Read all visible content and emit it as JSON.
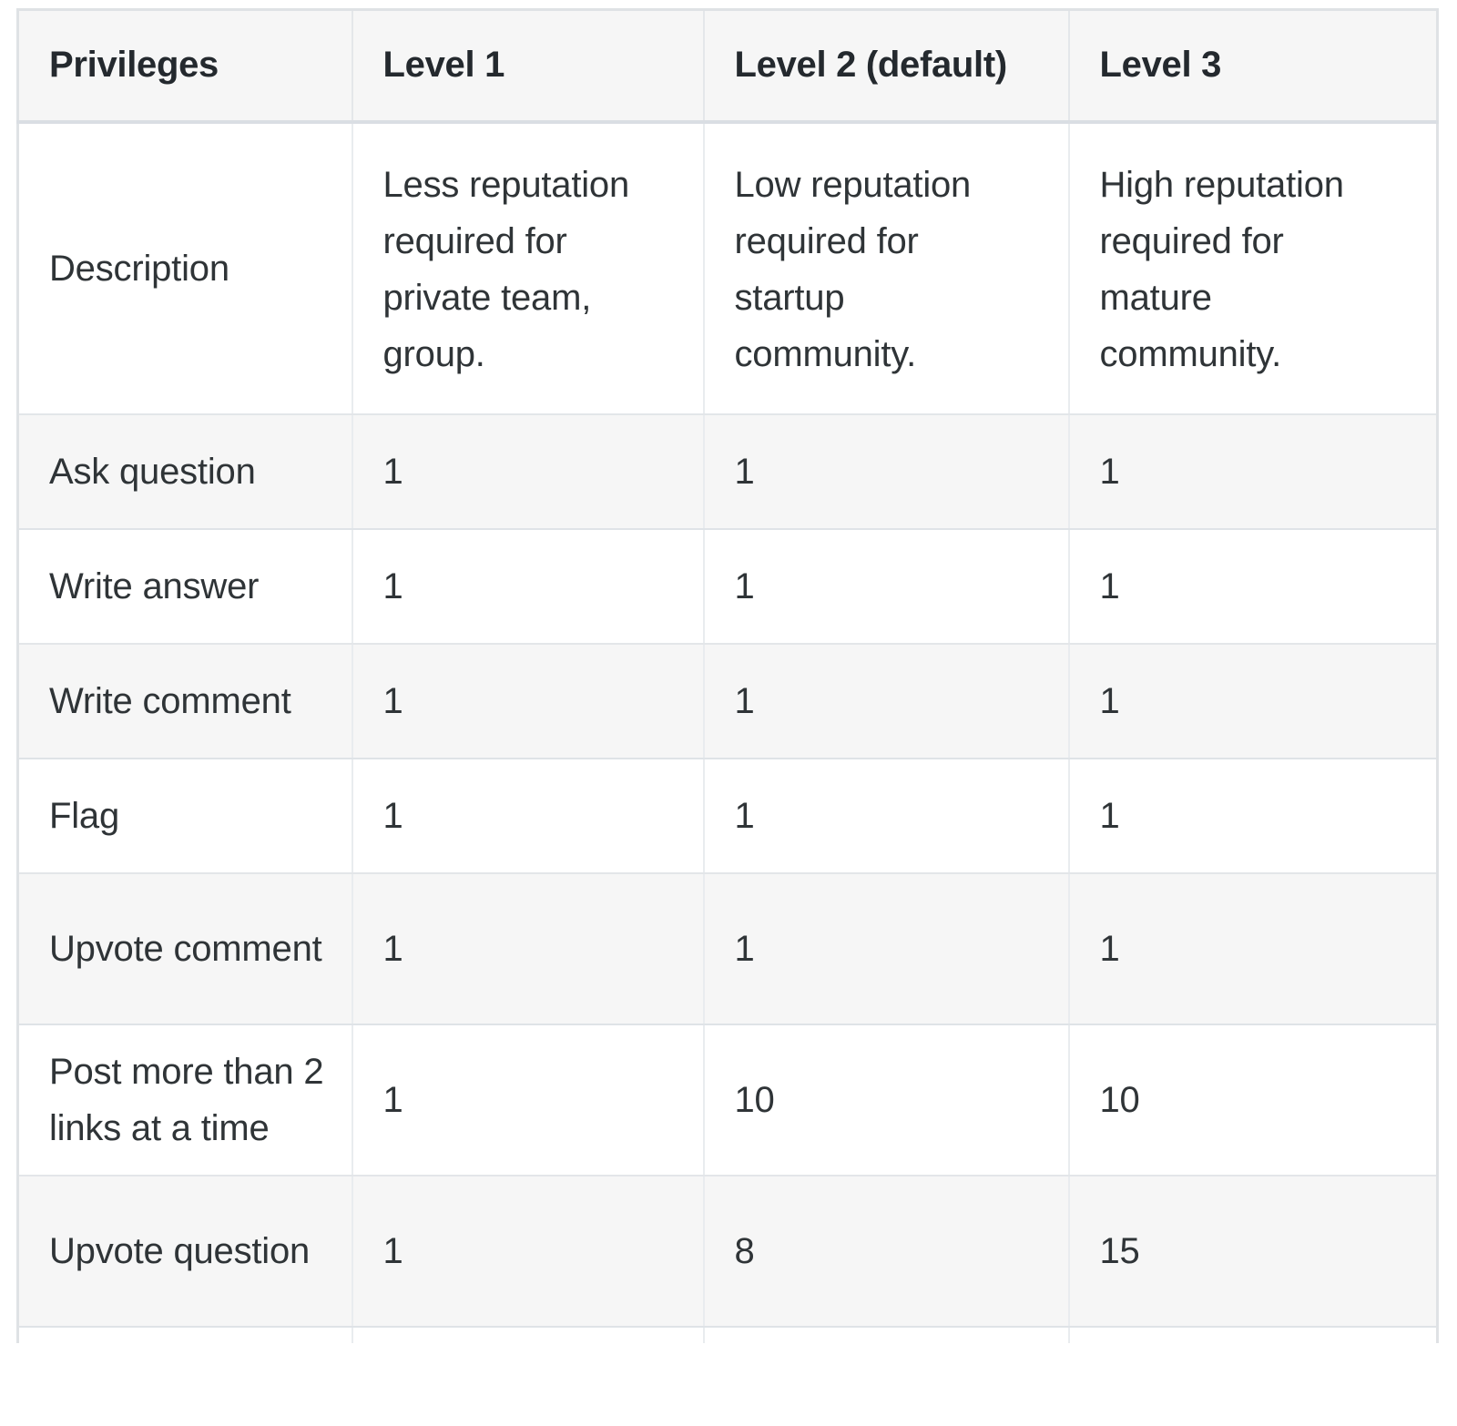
{
  "table": {
    "columns": [
      "Privileges",
      "Level 1",
      "Level 2 (default)",
      "Level 3"
    ],
    "rows": [
      {
        "label": "Description",
        "values": [
          "Less reputation required for private team, group.",
          "Low reputation required for startup community.",
          "High reputation required for mature community."
        ]
      },
      {
        "label": "Ask question",
        "values": [
          "1",
          "1",
          "1"
        ]
      },
      {
        "label": "Write answer",
        "values": [
          "1",
          "1",
          "1"
        ]
      },
      {
        "label": "Write comment",
        "values": [
          "1",
          "1",
          "1"
        ]
      },
      {
        "label": "Flag",
        "values": [
          "1",
          "1",
          "1"
        ]
      },
      {
        "label": "Upvote comment",
        "values": [
          "1",
          "1",
          "1"
        ]
      },
      {
        "label": "Post more than 2 links at a time",
        "values": [
          "1",
          "10",
          "10"
        ]
      },
      {
        "label": "Upvote question",
        "values": [
          "1",
          "8",
          "15"
        ]
      }
    ]
  },
  "colors": {
    "header_background": "#f6f6f6",
    "row_shade": "#f6f6f6",
    "row_plain": "#ffffff",
    "border": "#e3e6e9",
    "header_border": "#dadee3",
    "text": "#2f3437",
    "header_text": "#24292e"
  }
}
